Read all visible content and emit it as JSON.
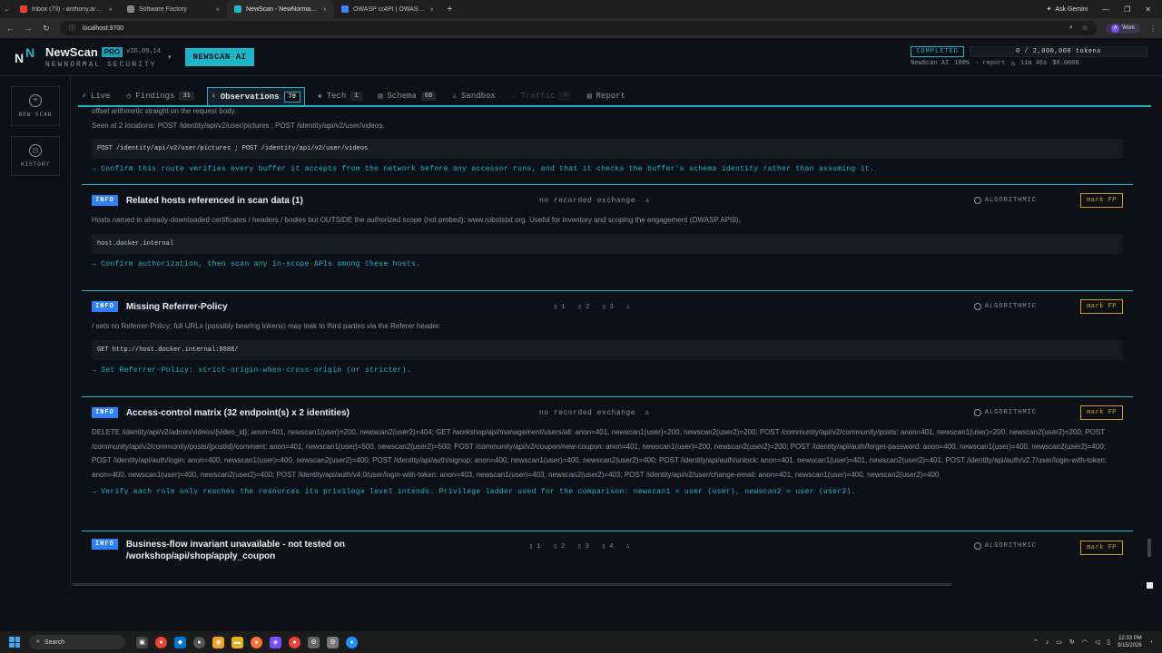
{
  "browser": {
    "tabs": [
      {
        "label": "Inbox (73) - anthony.araguesi@...",
        "color": "#ea4335"
      },
      {
        "label": "Software Factory",
        "color": "#888888"
      },
      {
        "label": "NewScan - NewNormal Security",
        "color": "#1fb5c9"
      },
      {
        "label": "OWASP crAPI | OWASP Foundat...",
        "color": "#4285f4"
      }
    ],
    "ask_gemini": "Ask Gemini",
    "url": "localhost:9700",
    "profile": "Work",
    "profile_initial": "A"
  },
  "header": {
    "brand_name": "NewScan",
    "pro": "PRO",
    "version": "v26.09.14",
    "subtitle": "NEWNORMAL SECURITY",
    "ai_button": "NEWSCAN AI",
    "status": "COMPLETED",
    "tokens": "0 / 2,000,000 tokens",
    "meta_model": "NewScan AI",
    "meta_pct": "100%",
    "meta_report": "· report",
    "meta_time": "11m 46s",
    "meta_cost": "$0.0000"
  },
  "sidebar": {
    "new_scan": "NEW SCAN",
    "history": "HISTORY"
  },
  "tabs": [
    {
      "label": "Live",
      "count": "",
      "icon": "⚡"
    },
    {
      "label": "Findings",
      "count": "31",
      "icon": "◷"
    },
    {
      "label": "Observations",
      "count": "70",
      "icon": "♀"
    },
    {
      "label": "Tech",
      "count": "1",
      "icon": "◈"
    },
    {
      "label": "Schema",
      "count": "68",
      "icon": "▥"
    },
    {
      "label": "Sandbox",
      "count": "",
      "icon": "♙"
    },
    {
      "label": "Traffic",
      "count": "0",
      "icon": "⚠"
    },
    {
      "label": "Report",
      "count": "",
      "icon": "▤"
    }
  ],
  "cards": {
    "c0": {
      "partial_line": "offset arithmetic straight on the request body.",
      "desc": "Seen at 2 locations: POST /identity/api/v2/user/pictures ; POST /identity/api/v2/user/videos.",
      "code": "POST /identity/api/v2/user/pictures ; POST /identity/api/v2/user/videos",
      "action": "→ Confirm this route verifies every buffer it accepts from the network before any accessor runs, and that it checks the buffer's schema identity rather than assuming it."
    },
    "c1": {
      "badge": "INFO",
      "title": "Related hosts referenced in scan data (1)",
      "exchange": "no recorded exchange",
      "algo": "ALGORITHMIC",
      "mark": "mark FP",
      "desc": "Hosts named in already-downloaded certificates / headers / bodies but OUTSIDE the authorized scope (not probed): www.robotstxt.org. Useful for inventory and scoping the engagement (OWASP API9).",
      "code": "host.docker.internal",
      "action": "→ Confirm authorization, then scan any in-scope APIs among these hosts."
    },
    "c2": {
      "badge": "INFO",
      "title": "Missing Referrer-Policy",
      "evidence": [
        "1",
        "2",
        "3"
      ],
      "algo": "ALGORITHMIC",
      "mark": "mark FP",
      "desc": "/ sets no Referrer-Policy; full URLs (possibly bearing tokens) may leak to third parties via the Referer header.",
      "code": "GET http://host.docker.internal:8888/",
      "action": "→ Set Referrer-Policy: strict-origin-when-cross-origin (or stricter)."
    },
    "c3": {
      "badge": "INFO",
      "title": "Access-control matrix (32 endpoint(s) x 2 identities)",
      "exchange": "no recorded exchange",
      "algo": "ALGORITHMIC",
      "mark": "mark FP",
      "desc": "DELETE /identity/api/v2/admin/videos/{video_id}: anon=401, newscan1(user)=200, newscan2(user2)=404; GET /workshop/api/management/users/all: anon=401, newscan1(user)=200, newscan2(user2)=200; POST /community/api/v2/community/posts: anon=401, newscan1(user)=200, newscan2(user2)=200; POST /community/api/v2/community/posts/{postId}/comment: anon=401, newscan1(user)=500, newscan2(user2)=500; POST /community/api/v2/coupon/new-coupon: anon=401, newscan1(user)=200, newscan2(user2)=200; POST /identity/api/auth/forget-password: anon=400, newscan1(user)=400, newscan2(user2)=400; POST /identity/api/auth/login: anon=400, newscan1(user)=400, newscan2(user2)=400; POST /identity/api/auth/signup: anon=400, newscan1(user)=400, newscan2(user2)=400; POST /identity/api/auth/unlock: anon=401, newscan1(user)=401, newscan2(user2)=401; POST /identity/api/auth/v2.7/user/login-with-token: anon=400, newscan1(user)=400, newscan2(user2)=400; POST /identity/api/auth/v4.0/user/login-with-token: anon=403, newscan1(user)=403, newscan2(user2)=403; POST /identity/api/v2/user/change-email: anon=401, newscan1(user)=400, newscan2(user2)=400",
      "action": "→ Verify each role only reaches the resources its privilege level intends. Privilege ladder used for the comparison: newscan1 = user (user), newscan2 = user (user2)."
    },
    "c4": {
      "badge": "INFO",
      "title_line1": "Business-flow invariant unavailable - not tested on",
      "title_line2": "/workshop/api/shop/apply_coupon",
      "evidence": [
        "1",
        "2",
        "3",
        "4"
      ],
      "algo": "ALGORITHMIC",
      "mark": "mark FP"
    }
  },
  "taskbar": {
    "search": "Search",
    "time": "12:33 PM",
    "date": "9/15/2026"
  }
}
